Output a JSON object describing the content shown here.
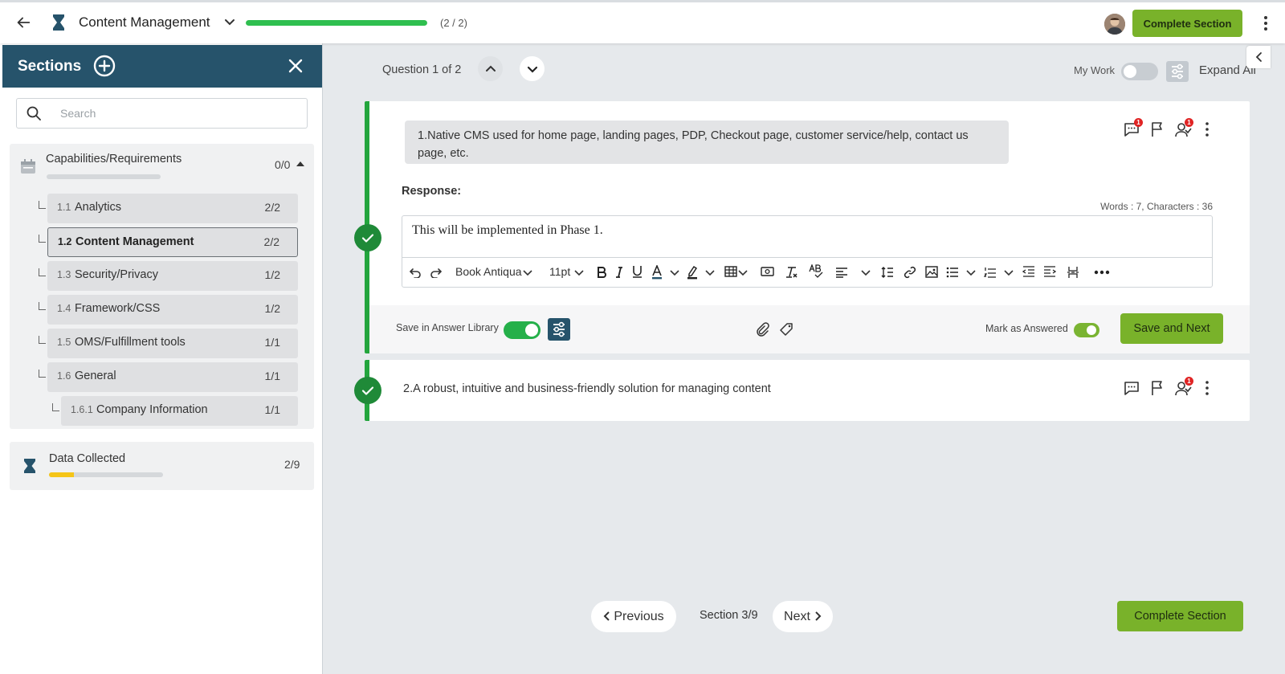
{
  "header": {
    "title": "Content Management",
    "progress_pct": 100,
    "progress_text": "(2 / 2)",
    "complete_label": "Complete Section"
  },
  "sidebar": {
    "title": "Sections",
    "search_placeholder": "Search",
    "groups": [
      {
        "title": "Capabilities/Requirements",
        "count": "0/0",
        "progress_pct": 0,
        "items": [
          {
            "num": "1.1",
            "label": "Analytics",
            "count": "2/2",
            "active": false
          },
          {
            "num": "1.2",
            "label": "Content Management",
            "count": "2/2",
            "active": true
          },
          {
            "num": "1.3",
            "label": "Security/Privacy",
            "count": "1/2",
            "active": false
          },
          {
            "num": "1.4",
            "label": "Framework/CSS",
            "count": "1/2",
            "active": false
          },
          {
            "num": "1.5",
            "label": "OMS/Fulfillment tools",
            "count": "1/1",
            "active": false
          },
          {
            "num": "1.6",
            "label": "General",
            "count": "1/1",
            "active": false
          },
          {
            "num": "1.6.1",
            "label": "Company Information",
            "count": "1/1",
            "active": false
          }
        ]
      },
      {
        "title": "Data Collected",
        "count": "2/9",
        "progress_pct": 22
      }
    ]
  },
  "main": {
    "question_nav": "Question 1 of 2",
    "my_work_label": "My Work",
    "my_work_on": false,
    "expand_all_label": "Expand All",
    "questions": [
      {
        "text": "1.Native CMS used for home page, landing pages, PDP, Checkout page, customer service/help, contact us page, etc.",
        "comment_badge": "1",
        "assign_badge": "1",
        "response_label": "Response:",
        "word_count": "Words : 7, Characters : 36",
        "response_text": "This will be implemented in Phase 1.",
        "toolbar": {
          "font": "Book Antiqua",
          "size": "11pt"
        },
        "save_library_label": "Save in Answer Library",
        "mark_answered_label": "Mark as Answered",
        "save_next_label": "Save and Next"
      },
      {
        "text": "2.A robust, intuitive and business-friendly solution for managing content",
        "assign_badge": "1"
      }
    ],
    "footer": {
      "prev_label": "Previous",
      "section_indicator": "Section 3/9",
      "next_label": "Next",
      "complete_label": "Complete Section"
    }
  },
  "colors": {
    "accent_green": "#79b22a",
    "header_teal": "#26536b",
    "progress_green": "#2fbf4f",
    "check_green": "#1f8a38"
  }
}
